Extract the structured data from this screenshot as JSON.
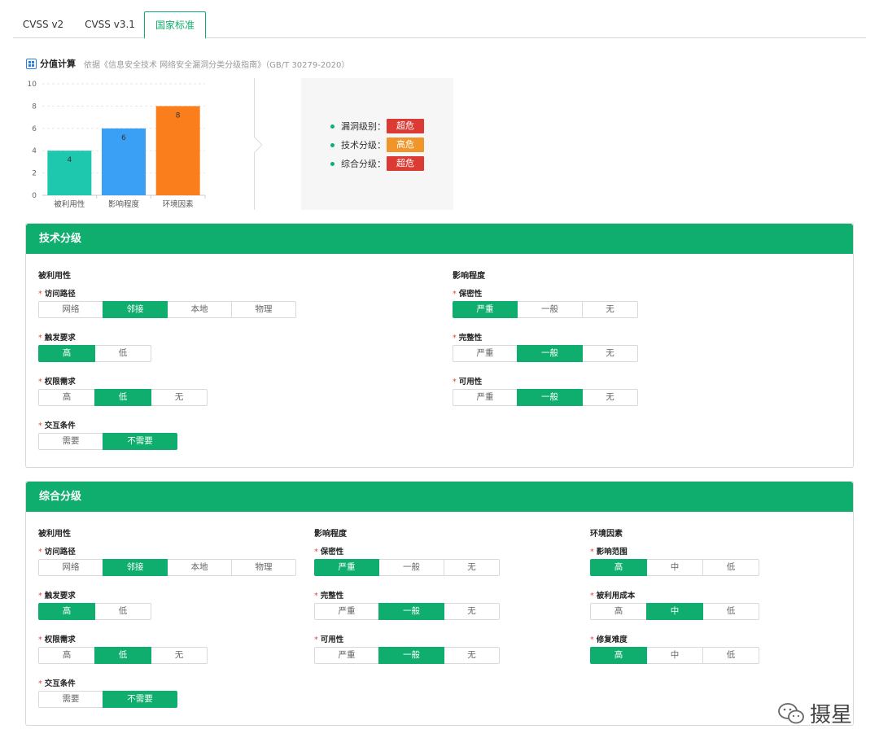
{
  "tabs": [
    {
      "label": "CVSS v2",
      "active": false
    },
    {
      "label": "CVSS v3.1",
      "active": false
    },
    {
      "label": "国家标准",
      "active": true
    }
  ],
  "score": {
    "title": "分值计算",
    "basis": "依据《信息安全技术 网络安全漏洞分类分级指南》（GB/T 30279-2020）"
  },
  "chart_data": {
    "type": "bar",
    "categories": [
      "被利用性",
      "影响程度",
      "环境因素"
    ],
    "values": [
      4,
      6,
      8
    ],
    "colors": [
      "#1ec8ae",
      "#3aa0f5",
      "#fb7e1c"
    ],
    "ylim": [
      0,
      10
    ],
    "yticks": [
      0,
      2,
      4,
      6,
      8,
      10
    ],
    "grid": true
  },
  "results": [
    {
      "label": "漏洞级别：",
      "value": "超危",
      "color": "#dc3b35"
    },
    {
      "label": "技术分级：",
      "value": "高危",
      "color": "#f0952a"
    },
    {
      "label": "综合分级：",
      "value": "超危",
      "color": "#dc3b35"
    }
  ],
  "tech": {
    "title": "技术分级",
    "exploit": {
      "title": "被利用性",
      "access": {
        "label": "访问路径",
        "options": [
          "网络",
          "邻接",
          "本地",
          "物理"
        ],
        "selected": 1
      },
      "trigger": {
        "label": "触发要求",
        "options": [
          "高",
          "低"
        ],
        "selected": 0
      },
      "privilege": {
        "label": "权限需求",
        "options": [
          "高",
          "低",
          "无"
        ],
        "selected": 1
      },
      "interaction": {
        "label": "交互条件",
        "options": [
          "需要",
          "不需要"
        ],
        "selected": 1
      }
    },
    "impact": {
      "title": "影响程度",
      "confidentiality": {
        "label": "保密性",
        "options": [
          "严重",
          "一般",
          "无"
        ],
        "selected": 0
      },
      "integrity": {
        "label": "完整性",
        "options": [
          "严重",
          "一般",
          "无"
        ],
        "selected": 1
      },
      "availability": {
        "label": "可用性",
        "options": [
          "严重",
          "一般",
          "无"
        ],
        "selected": 1
      }
    }
  },
  "overall": {
    "title": "综合分级",
    "exploit": {
      "title": "被利用性",
      "access": {
        "label": "访问路径",
        "options": [
          "网络",
          "邻接",
          "本地",
          "物理"
        ],
        "selected": 1
      },
      "trigger": {
        "label": "触发要求",
        "options": [
          "高",
          "低"
        ],
        "selected": 0
      },
      "privilege": {
        "label": "权限需求",
        "options": [
          "高",
          "低",
          "无"
        ],
        "selected": 1
      },
      "interaction": {
        "label": "交互条件",
        "options": [
          "需要",
          "不需要"
        ],
        "selected": 1
      }
    },
    "impact": {
      "title": "影响程度",
      "confidentiality": {
        "label": "保密性",
        "options": [
          "严重",
          "一般",
          "无"
        ],
        "selected": 0
      },
      "integrity": {
        "label": "完整性",
        "options": [
          "严重",
          "一般",
          "无"
        ],
        "selected": 1
      },
      "availability": {
        "label": "可用性",
        "options": [
          "严重",
          "一般",
          "无"
        ],
        "selected": 1
      }
    },
    "env": {
      "title": "环境因素",
      "scope": {
        "label": "影响范围",
        "options": [
          "高",
          "中",
          "低"
        ],
        "selected": 0
      },
      "cost": {
        "label": "被利用成本",
        "options": [
          "高",
          "中",
          "低"
        ],
        "selected": 1
      },
      "repair": {
        "label": "修复难度",
        "options": [
          "高",
          "中",
          "低"
        ],
        "selected": 0
      }
    }
  },
  "watermark": {
    "text": "摄星"
  }
}
